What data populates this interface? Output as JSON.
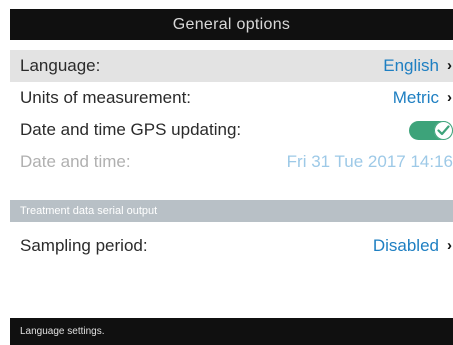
{
  "header": {
    "title": "General options"
  },
  "rows": [
    {
      "label": "Language:",
      "value": "English"
    },
    {
      "label": "Units of measurement:",
      "value": "Metric"
    },
    {
      "label": "Date and time GPS updating:",
      "toggle_on": true
    },
    {
      "label": "Date and time:",
      "value": "Fri 31 Tue 2017 14:16"
    }
  ],
  "section": {
    "title": "Treatment data serial output",
    "rows": [
      {
        "label": "Sampling period:",
        "value": "Disabled"
      }
    ]
  },
  "footer": {
    "hint": "Language settings."
  },
  "icons": {
    "chevron": "chevron-right-icon",
    "toggle_check": "check-icon"
  },
  "colors": {
    "accent": "#1e7fc2",
    "accent_disabled": "#9dc9e7",
    "toggle_on": "#3da37a",
    "bar_background": "#101010",
    "section_background": "#b8c0c6",
    "selected_row": "#e3e3e3"
  }
}
